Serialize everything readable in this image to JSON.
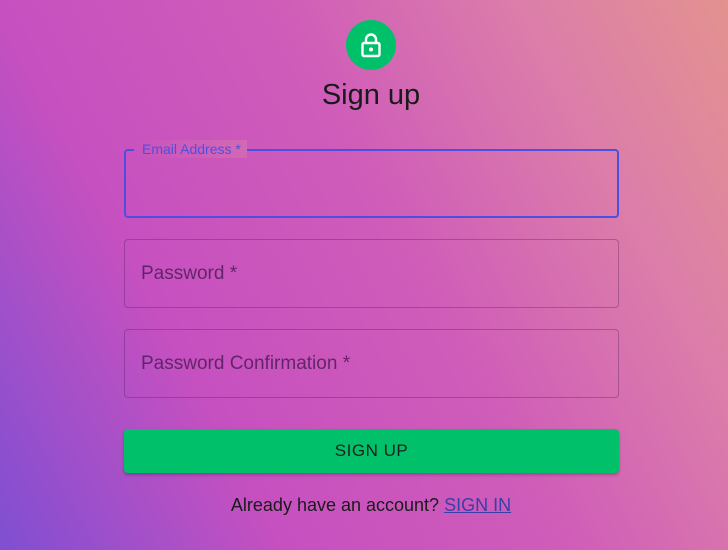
{
  "header": {
    "icon": "lock-icon",
    "title": "Sign up"
  },
  "form": {
    "email": {
      "label": "Email Address *",
      "value": "",
      "focused": true
    },
    "password": {
      "label": "Password *",
      "value": ""
    },
    "password_confirmation": {
      "label": "Password Confirmation *",
      "value": ""
    },
    "submit_label": "SIGN UP"
  },
  "footer": {
    "prompt": "Already have an account?",
    "link_label": "SIGN IN"
  },
  "colors": {
    "accent": "#00c16a",
    "focus": "#4d4fe0",
    "link": "#3a3ea8"
  }
}
